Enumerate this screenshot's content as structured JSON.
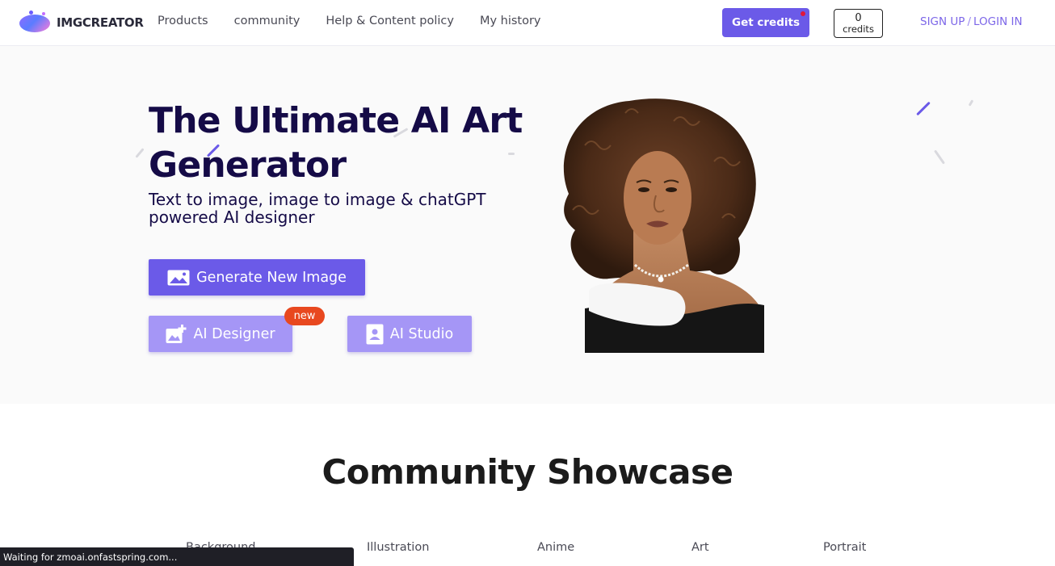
{
  "header": {
    "logo_text": "IMGCREATOR",
    "nav": [
      "Products",
      "community",
      "Help & Content policy",
      "My history"
    ],
    "get_credits_label": "Get credits",
    "credits_count": "0",
    "credits_label": "credits",
    "signup_label": "SIGN UP",
    "auth_separator": "/",
    "login_label": "LOGIN IN"
  },
  "hero": {
    "title": "The Ultimate AI Art Generator",
    "subtitle": "Text to image, image to image & chatGPT powered AI designer",
    "generate_button": "Generate New Image",
    "designer_button": "AI Designer",
    "designer_badge": "new",
    "studio_button": "AI Studio"
  },
  "showcase": {
    "title": "Community Showcase",
    "tabs": [
      "Background",
      "Illustration",
      "Anime",
      "Art",
      "Portrait"
    ]
  },
  "status_bar": {
    "text": "Waiting for zmoai.onfastspring.com..."
  },
  "colors": {
    "primary": "#6b5ae8",
    "primary_light": "#a596f6",
    "badge": "#e8481f",
    "title": "#150b47",
    "auth": "#7c66e8"
  },
  "icons": {
    "generate": "image-icon",
    "designer": "add-image-icon",
    "studio": "portrait-card-icon"
  }
}
